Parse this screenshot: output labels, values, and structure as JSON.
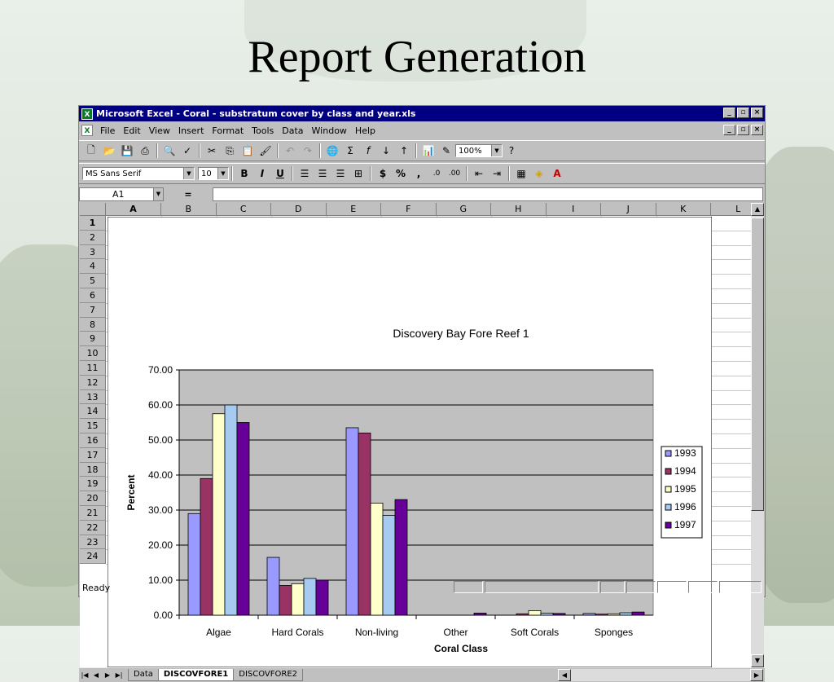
{
  "slide": {
    "title": "Report Generation"
  },
  "window": {
    "title": "Microsoft Excel - Coral - substratum cover by class and year.xls",
    "controls": [
      "_",
      "×"
    ]
  },
  "menu": [
    "File",
    "Edit",
    "View",
    "Insert",
    "Format",
    "Tools",
    "Data",
    "Window",
    "Help"
  ],
  "toolbar": {
    "zoom": "100%"
  },
  "format_toolbar": {
    "font": "MS Sans Serif",
    "size": "10",
    "bold": "B",
    "italic": "I",
    "underline": "U",
    "currency": "$",
    "percent": "%",
    "comma": ","
  },
  "formula_bar": {
    "name_box": "A1",
    "equals": "="
  },
  "columns": [
    "A",
    "B",
    "C",
    "D",
    "E",
    "F",
    "G",
    "H",
    "I",
    "J",
    "K",
    "L"
  ],
  "rows": [
    "1",
    "2",
    "3",
    "4",
    "5",
    "6",
    "7",
    "8",
    "9",
    "10",
    "11",
    "12",
    "13",
    "14",
    "15",
    "16",
    "17",
    "18",
    "19",
    "20",
    "21",
    "22",
    "23",
    "24"
  ],
  "sheets": [
    "Data",
    "DISCOVFORE1",
    "DISCOVFORE2"
  ],
  "active_sheet": "DISCOVFORE1",
  "status": "Ready",
  "colors": {
    "titlebar": "#000080",
    "plot_bg": "#c0c0c0"
  },
  "chart_data": {
    "type": "bar",
    "title": "Discovery Bay Fore Reef 1",
    "xlabel": "Coral Class",
    "ylabel": "Percent",
    "ylim": [
      0,
      70
    ],
    "yticks": [
      "0.00",
      "10.00",
      "20.00",
      "30.00",
      "40.00",
      "50.00",
      "60.00",
      "70.00"
    ],
    "categories": [
      "Algae",
      "Hard Corals",
      "Non-living",
      "Other",
      "Soft Corals",
      "Sponges"
    ],
    "legend_position": "right",
    "series": [
      {
        "name": "1993",
        "color": "#9999ff",
        "values": [
          29.0,
          16.5,
          53.5,
          0.0,
          0.0,
          0.5
        ]
      },
      {
        "name": "1994",
        "color": "#993366",
        "values": [
          39.0,
          8.5,
          52.0,
          0.0,
          0.4,
          0.3
        ]
      },
      {
        "name": "1995",
        "color": "#ffffcc",
        "values": [
          57.5,
          9.0,
          32.0,
          0.0,
          1.3,
          0.4
        ]
      },
      {
        "name": "1996",
        "color": "#a6caf0",
        "values": [
          60.0,
          10.5,
          28.5,
          0.0,
          0.6,
          0.7
        ]
      },
      {
        "name": "1997",
        "color": "#660099",
        "values": [
          55.0,
          10.0,
          33.0,
          0.6,
          0.5,
          0.9
        ]
      }
    ]
  }
}
